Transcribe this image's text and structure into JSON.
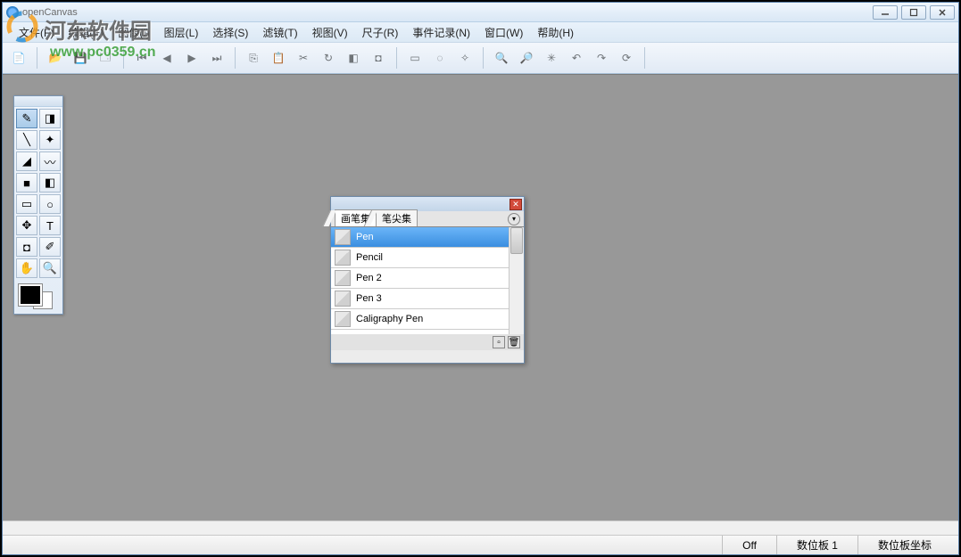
{
  "window": {
    "title": "openCanvas"
  },
  "menu": [
    {
      "label": "文件(F)"
    },
    {
      "label": "编辑(E)"
    },
    {
      "label": "图像(I)"
    },
    {
      "label": "图层(L)"
    },
    {
      "label": "选择(S)"
    },
    {
      "label": "滤镜(T)"
    },
    {
      "label": "视图(V)"
    },
    {
      "label": "尺子(R)"
    },
    {
      "label": "事件记录(N)"
    },
    {
      "label": "窗口(W)"
    },
    {
      "label": "帮助(H)"
    }
  ],
  "toolbar_icons": {
    "new": "new-file-icon",
    "open": "open-folder-icon",
    "save": "save-icon",
    "print": "print-icon",
    "undonav1": "nav-first-icon",
    "undonav2": "nav-prev-icon",
    "undonav3": "nav-next-icon",
    "undonav4": "nav-last-icon",
    "copy": "copy-icon",
    "paste": "paste-icon",
    "cut": "cut-icon",
    "rotate": "rotate-icon",
    "eraser": "eraser-icon",
    "crop": "crop-icon",
    "sel1": "select-rect-icon",
    "sel2": "select-lasso-icon",
    "sel3": "select-wand-icon",
    "zoomin": "zoom-in-icon",
    "zoomout": "zoom-out-icon",
    "reset": "reset-view-icon",
    "undo": "undo-icon",
    "redo": "redo-icon",
    "refresh": "refresh-icon"
  },
  "tools": [
    {
      "name": "pen-tool",
      "glyph": "✎",
      "selected": true
    },
    {
      "name": "eraser-tool",
      "glyph": "◨",
      "selected": false
    },
    {
      "name": "brush-tool",
      "glyph": "╲",
      "selected": false
    },
    {
      "name": "clone-tool",
      "glyph": "✦",
      "selected": false
    },
    {
      "name": "fill-tool",
      "glyph": "◢",
      "selected": false
    },
    {
      "name": "smudge-tool",
      "glyph": "〰",
      "selected": false
    },
    {
      "name": "shape-tool",
      "glyph": "■",
      "selected": false
    },
    {
      "name": "gradient-tool",
      "glyph": "◧",
      "selected": false
    },
    {
      "name": "select-rect-tool",
      "glyph": "▭",
      "selected": false
    },
    {
      "name": "select-oval-tool",
      "glyph": "○",
      "selected": false
    },
    {
      "name": "move-tool",
      "glyph": "✥",
      "selected": false
    },
    {
      "name": "text-tool",
      "glyph": "T",
      "selected": false
    },
    {
      "name": "crop-tool",
      "glyph": "◘",
      "selected": false
    },
    {
      "name": "eyedropper-tool",
      "glyph": "✐",
      "selected": false
    },
    {
      "name": "hand-tool",
      "glyph": "✋",
      "selected": false
    },
    {
      "name": "zoom-tool",
      "glyph": "🔍",
      "selected": false
    }
  ],
  "colors": {
    "fg": "#000000",
    "bg": "#ffffff"
  },
  "brush_panel": {
    "tabs": [
      {
        "label": "画笔集",
        "active": true
      },
      {
        "label": "笔尖集",
        "active": false
      }
    ],
    "items": [
      {
        "label": "Pen",
        "selected": true
      },
      {
        "label": "Pencil",
        "selected": false
      },
      {
        "label": "Pen 2",
        "selected": false
      },
      {
        "label": "Pen 3",
        "selected": false
      },
      {
        "label": "Caligraphy Pen",
        "selected": false
      }
    ]
  },
  "status": {
    "off": "Off",
    "tablet": "数位板 1",
    "coords": "数位板坐标"
  },
  "watermark": {
    "line1": "河东软件园",
    "line2": "www.pc0359.cn"
  }
}
